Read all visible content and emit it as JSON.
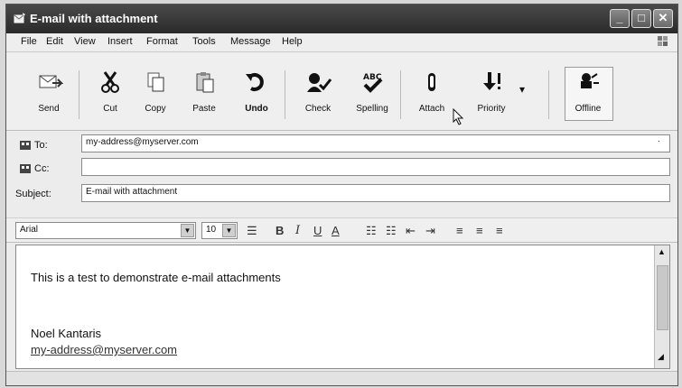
{
  "window": {
    "title": "E-mail with attachment",
    "icon": "new-mail-icon",
    "controls": [
      "minimize",
      "maximize",
      "close"
    ]
  },
  "menu": [
    "File",
    "Edit",
    "View",
    "Insert",
    "Format",
    "Tools",
    "Message",
    "Help"
  ],
  "toolbar": {
    "send": "Send",
    "cut": "Cut",
    "copy": "Copy",
    "paste": "Paste",
    "undo": "Undo",
    "check": "Check",
    "spelling": "Spelling",
    "attach": "Attach",
    "priority": "Priority",
    "offline": "Offline"
  },
  "fields": {
    "to_label": "To:",
    "to_value": "my-address@myserver.com",
    "cc_label": "Cc:",
    "cc_value": "",
    "subject_label": "Subject:",
    "subject_value": "E-mail with attachment"
  },
  "format": {
    "font": "Arial",
    "size": "10"
  },
  "message": {
    "line1": "This is a test to demonstrate e-mail attachments",
    "signature_name": "Noel Kantaris",
    "signature_email": "my-address@myserver.com"
  },
  "colors": {
    "title_bar": "#333333",
    "window_bg": "#ececec"
  }
}
